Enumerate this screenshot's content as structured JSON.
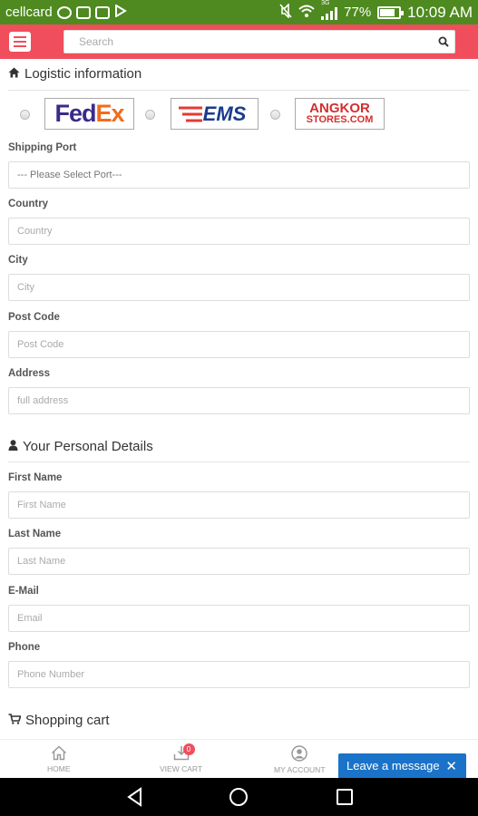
{
  "status_bar": {
    "carrier": "cellcard",
    "network": "3G",
    "battery": "77%",
    "time": "10:09 AM"
  },
  "header": {
    "search_placeholder": "Search"
  },
  "logistic": {
    "title": "Logistic information",
    "carriers": [
      {
        "name": "FedEx",
        "part1": "Fed",
        "part2": "Ex"
      },
      {
        "name": "EMS"
      },
      {
        "name": "ANGKOR STORES.COM",
        "line1": "ANGKOR",
        "line2": "STORES.COM"
      }
    ],
    "shipping_port_label": "Shipping Port",
    "shipping_port_value": "--- Please Select Port---",
    "country_label": "Country",
    "country_placeholder": "Country",
    "city_label": "City",
    "city_placeholder": "City",
    "postcode_label": "Post Code",
    "postcode_placeholder": "Post Code",
    "address_label": "Address",
    "address_placeholder": "full address"
  },
  "personal": {
    "title": "Your Personal Details",
    "first_name_label": "First Name",
    "first_name_placeholder": "First Name",
    "last_name_label": "Last Name",
    "last_name_placeholder": "Last Name",
    "email_label": "E-Mail",
    "email_placeholder": "Email",
    "phone_label": "Phone",
    "phone_placeholder": "Phone Number"
  },
  "cart": {
    "title": "Shopping cart"
  },
  "bottom_nav": {
    "home": "HOME",
    "view_cart": "VIEW CART",
    "cart_count": "0",
    "my_account": "MY ACCOUNT"
  },
  "chat": {
    "label": "Leave a message",
    "close": "✕"
  },
  "colors": {
    "status_bar": "#4e8a1f",
    "header": "#f04e5c",
    "chat": "#1a73c8"
  }
}
